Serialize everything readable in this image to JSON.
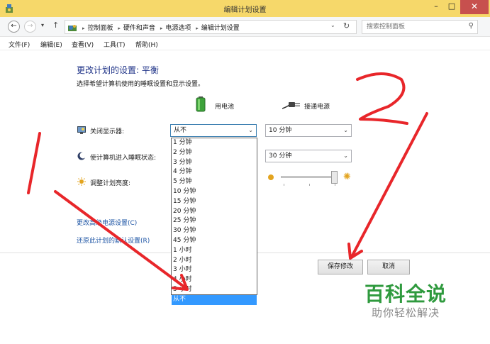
{
  "window": {
    "title": "编辑计划设置",
    "minimize_glyph": "–",
    "maximize_glyph": "□",
    "close_glyph": "✕"
  },
  "address_bar": {
    "back_glyph": "←",
    "forward_glyph": "→",
    "recent_glyph": "▾",
    "up_glyph": "↑",
    "breadcrumbs": [
      "控制面板",
      "硬件和声音",
      "电源选项",
      "编辑计划设置"
    ],
    "separator": "▸",
    "dropdown_glyph": "⌄",
    "refresh_glyph": "↻",
    "search_placeholder": "搜索控制面板",
    "search_glyph": "⚲"
  },
  "menu": {
    "items": [
      "文件(F)",
      "编辑(E)",
      "查看(V)",
      "工具(T)",
      "帮助(H)"
    ]
  },
  "plan": {
    "heading": "更改计划的设置: 平衡",
    "subheading": "选择希望计算机使用的睡眠设置和显示设置。",
    "battery_label": "用电池",
    "plugged_label": "接通电源",
    "display_off_label": "关闭显示器:",
    "display_off_battery": "从不",
    "display_off_plugged": "10 分钟",
    "sleep_label": "使计算机进入睡眠状态:",
    "sleep_plugged": "30 分钟",
    "brightness_label": "调整计划亮度:",
    "brightness_plugged_level": 0.95,
    "select_arrow": "⌄"
  },
  "dropdown": {
    "options": [
      "1 分钟",
      "2 分钟",
      "3 分钟",
      "4 分钟",
      "5 分钟",
      "10 分钟",
      "15 分钟",
      "20 分钟",
      "25 分钟",
      "30 分钟",
      "45 分钟",
      "1 小时",
      "2 小时",
      "3 小时",
      "4 小时",
      "5 小时",
      "从不"
    ],
    "selected": "从不"
  },
  "links": {
    "advanced": "更改高级电源设置(C)",
    "restore": "还原此计划的默认设置(R)"
  },
  "buttons": {
    "save": "保存修改",
    "cancel": "取消"
  },
  "watermark": {
    "main": "百科全说",
    "sub": "助你轻松解决"
  },
  "annotations": {
    "mark_1": "1",
    "mark_2": "2",
    "color": "#e8262a"
  }
}
